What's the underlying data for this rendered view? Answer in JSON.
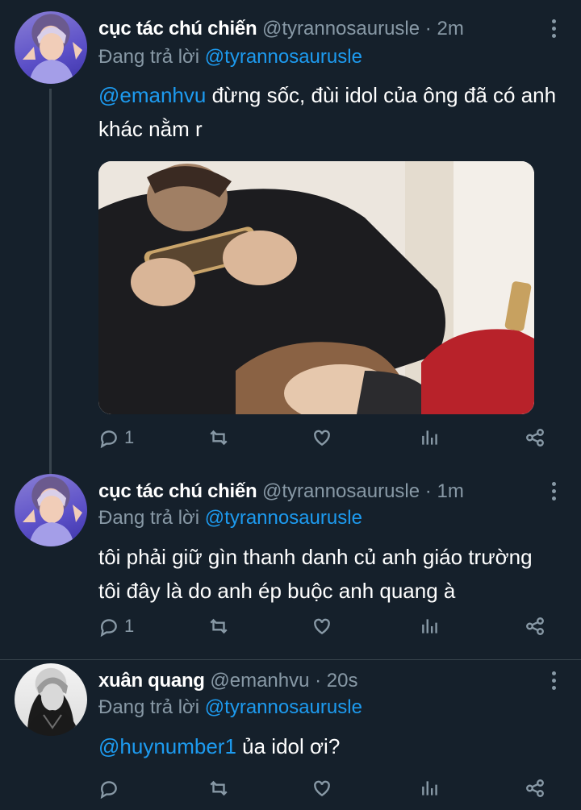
{
  "tweets": [
    {
      "name": "cục tác chú chiến",
      "handle": "@tyrannosaurusle",
      "time": "2m",
      "reply_prefix": "Đang trả lời",
      "reply_to": "@tyrannosaurusle",
      "mention": "@emanhvu",
      "text": " đừng sốc, đùi idol của ông đã có anh khác nằm r",
      "reply_count": "1",
      "avatar_icon": "avatar-purple"
    },
    {
      "name": "cục tác chú chiến",
      "handle": "@tyrannosaurusle",
      "time": "1m",
      "reply_prefix": "Đang trả lời",
      "reply_to": "@tyrannosaurusle",
      "text": "tôi phải giữ gìn thanh danh củ anh giáo trường tôi đây là do anh ép buộc anh quang à",
      "reply_count": "1",
      "avatar_icon": "avatar-purple"
    },
    {
      "name": "xuân quang",
      "handle": "@emanhvu",
      "time": "20s",
      "reply_prefix": "Đang trả lời",
      "reply_to": "@tyrannosaurusle",
      "mention": "@huynumber1",
      "text": " ủa idol ơi?",
      "avatar_icon": "avatar-bw"
    }
  ],
  "separator": "·",
  "colors": {
    "background": "#15202b",
    "link": "#1d9bf0",
    "muted": "#8899a6"
  }
}
